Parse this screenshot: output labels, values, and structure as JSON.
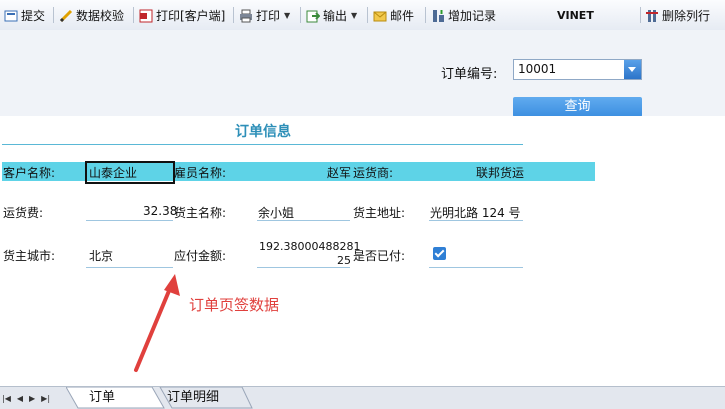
{
  "toolbar": {
    "submit": "提交",
    "validate": "数据校验",
    "print_client": "打印[客户端]",
    "print": "打印",
    "export": "输出",
    "mail": "邮件",
    "add_record": "增加记录",
    "vinet": "VINET",
    "delete_row": "删除列行",
    "icons": [
      "submit-icon",
      "pencil-icon",
      "pdf-icon",
      "printer-icon",
      "export-icon",
      "mail-icon",
      "add-record-icon",
      "delete-row-icon"
    ]
  },
  "param": {
    "order_label": "订单编号:",
    "order_value": "10001",
    "query": "查询"
  },
  "form": {
    "title": "订单信息",
    "customer_label": "客户名称:",
    "customer_value": "山泰企业",
    "employee_label": "雇员名称:",
    "employee_value": "赵军",
    "shipper_label": "运货商:",
    "shipper_value": "联邦货运",
    "freight_label": "运货费:",
    "freight_value": "32.38",
    "owner_name_label": "货主名称:",
    "owner_name_value": "余小姐",
    "owner_addr_label": "货主地址:",
    "owner_addr_value": "光明北路 124 号",
    "owner_city_label": "货主城市:",
    "owner_city_value": "北京",
    "amount_label": "应付金额:",
    "amount_line1": "192.38000488281",
    "amount_line2": "25",
    "paid_label": "是否已付:",
    "paid": true
  },
  "annotation": "订单页签数据",
  "tabs": [
    {
      "label": "订单",
      "active": true
    },
    {
      "label": "订单明细",
      "active": false
    }
  ],
  "colors": {
    "accent": "#2d8fb8",
    "highlight_row": "#5ed3e7",
    "annotation": "#e0403d",
    "button": "#3b8ee0"
  }
}
